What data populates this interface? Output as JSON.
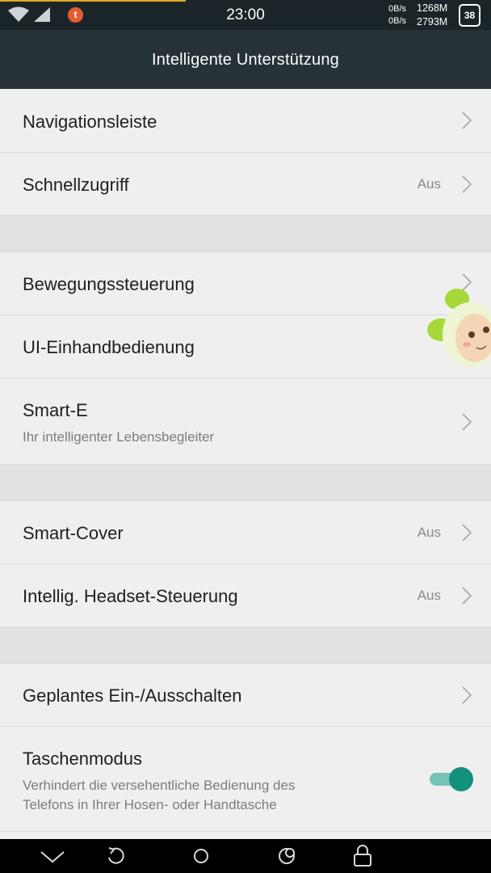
{
  "status_bar": {
    "time": "23:00",
    "net_up": "0B/s",
    "net_down": "0B/s",
    "mem_1": "1268M",
    "mem_2": "2793M",
    "battery": "38",
    "notification_glyph": "t",
    "accent_color": "#e0a823"
  },
  "header": {
    "title": "Intelligente Unterstützung"
  },
  "items": {
    "navigationsleiste": {
      "label": "Navigationsleiste"
    },
    "schnellzugriff": {
      "label": "Schnellzugriff",
      "value": "Aus"
    },
    "bewegungssteuerung": {
      "label": "Bewegungssteuerung"
    },
    "einhand": {
      "label": "UI-Einhandbedienung"
    },
    "smart_e": {
      "label": "Smart-E",
      "subtitle": "Ihr intelligenter Lebensbegleiter"
    },
    "smart_cover": {
      "label": "Smart-Cover",
      "value": "Aus"
    },
    "headset": {
      "label": "Intellig. Headset-Steuerung",
      "value": "Aus"
    },
    "geplant": {
      "label": "Geplantes Ein-/Ausschalten"
    },
    "taschenmodus": {
      "label": "Taschenmodus",
      "subtitle_line1": "Verhindert die versehentliche Bedienung des",
      "subtitle_line2": "Telefons in Ihrer Hosen- oder Handtasche",
      "enabled": true,
      "toggle_color": "#11907a"
    }
  },
  "navbar": {
    "icons": [
      "chevron-down-icon",
      "back-icon",
      "home-icon",
      "recents-icon",
      "lock-icon"
    ]
  }
}
